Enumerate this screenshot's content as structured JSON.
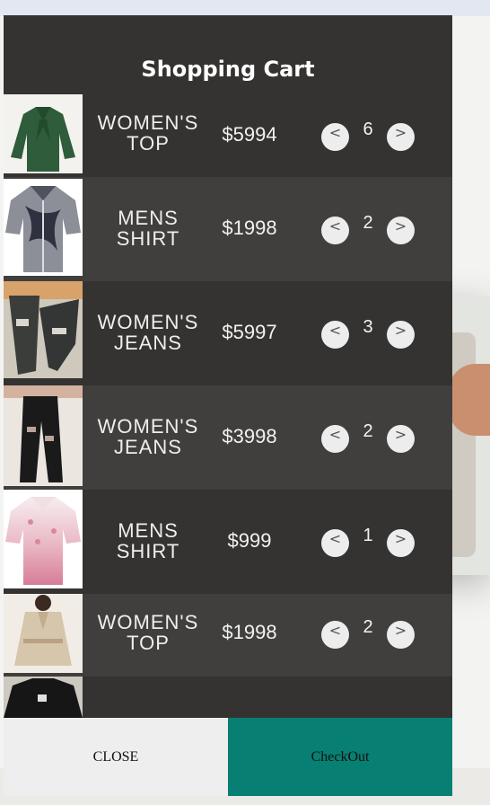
{
  "cart": {
    "title": "Shopping Cart",
    "decrement_icon": "<",
    "increment_icon": ">",
    "items": [
      {
        "name": "WOMEN'S TOP",
        "price": "$5994",
        "qty": "6",
        "thumb": "green-blouse"
      },
      {
        "name": "MENS SHIRT",
        "price": "$1998",
        "qty": "2",
        "thumb": "tie-dye-shirt"
      },
      {
        "name": "WOMEN'S JEANS",
        "price": "$5997",
        "qty": "3",
        "thumb": "ripped-jeans-grey"
      },
      {
        "name": "WOMEN'S JEANS",
        "price": "$3998",
        "qty": "2",
        "thumb": "ripped-jeans-black"
      },
      {
        "name": "MENS SHIRT",
        "price": "$999",
        "qty": "1",
        "thumb": "pink-gradient-shirt"
      },
      {
        "name": "WOMEN'S TOP",
        "price": "$1998",
        "qty": "2",
        "thumb": "beige-trench-top"
      },
      {
        "name": "",
        "price": "",
        "qty": "",
        "thumb": "black-tshirt"
      }
    ]
  },
  "footer": {
    "close_label": "CLOSE",
    "checkout_label": "CheckOut"
  },
  "colors": {
    "panel": "#343331",
    "row_alt": "#403f3d",
    "checkout": "#087f73"
  }
}
